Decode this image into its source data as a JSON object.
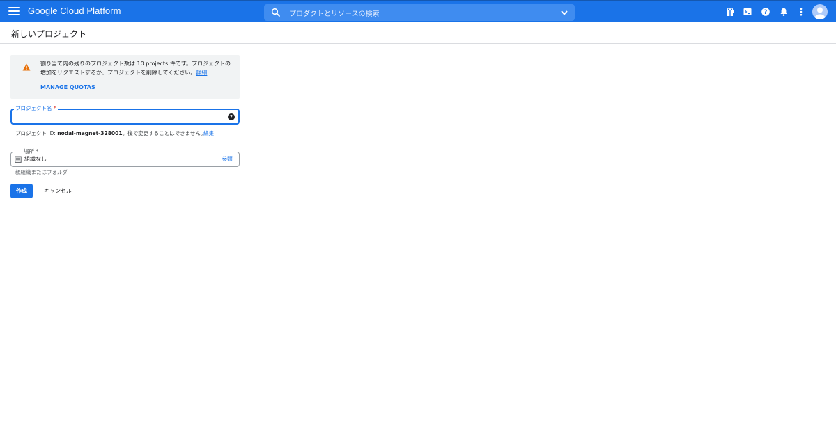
{
  "header": {
    "app_title": "Google Cloud Platform",
    "search_placeholder": "プロダクトとリソースの検索",
    "icons": [
      "menu-icon",
      "search-icon",
      "chevron-down-icon",
      "gift-icon",
      "cloud-shell-icon",
      "help-icon",
      "notifications-icon",
      "more-vert-icon",
      "account-avatar"
    ],
    "colors": {
      "bar": "#1a73e8",
      "search_bg": "#3f8cf0"
    }
  },
  "page": {
    "title": "新しいプロジェクト"
  },
  "quota_notice": {
    "icon": "warning-icon",
    "text": "割り当て内の残りのプロジェクト数は 10 projects 件です。プロジェクトの増加をリクエストするか、プロジェクトを削除してください。",
    "details_link": "詳細",
    "manage_quotas": "MANAGE QUOTAS",
    "colors": {
      "background": "#f1f3f4",
      "warning": "#e8710a"
    }
  },
  "project_name_field": {
    "label": "プロジェクト名",
    "required_mark": "*",
    "value": "",
    "help_icon": "?"
  },
  "project_id": {
    "prefix": "プロジェクト ID: ",
    "id": "nodal-magnet-328001",
    "suffix": "。後で変更することはできません。",
    "edit_link": "編集"
  },
  "location_field": {
    "label": "場所 *",
    "value": "組織なし",
    "browse_link": "参照",
    "helper": "親組織またはフォルダ",
    "icon": "organization-icon"
  },
  "actions": {
    "create": "作成",
    "cancel": "キャンセル"
  },
  "accent_color": "#1a73e8"
}
